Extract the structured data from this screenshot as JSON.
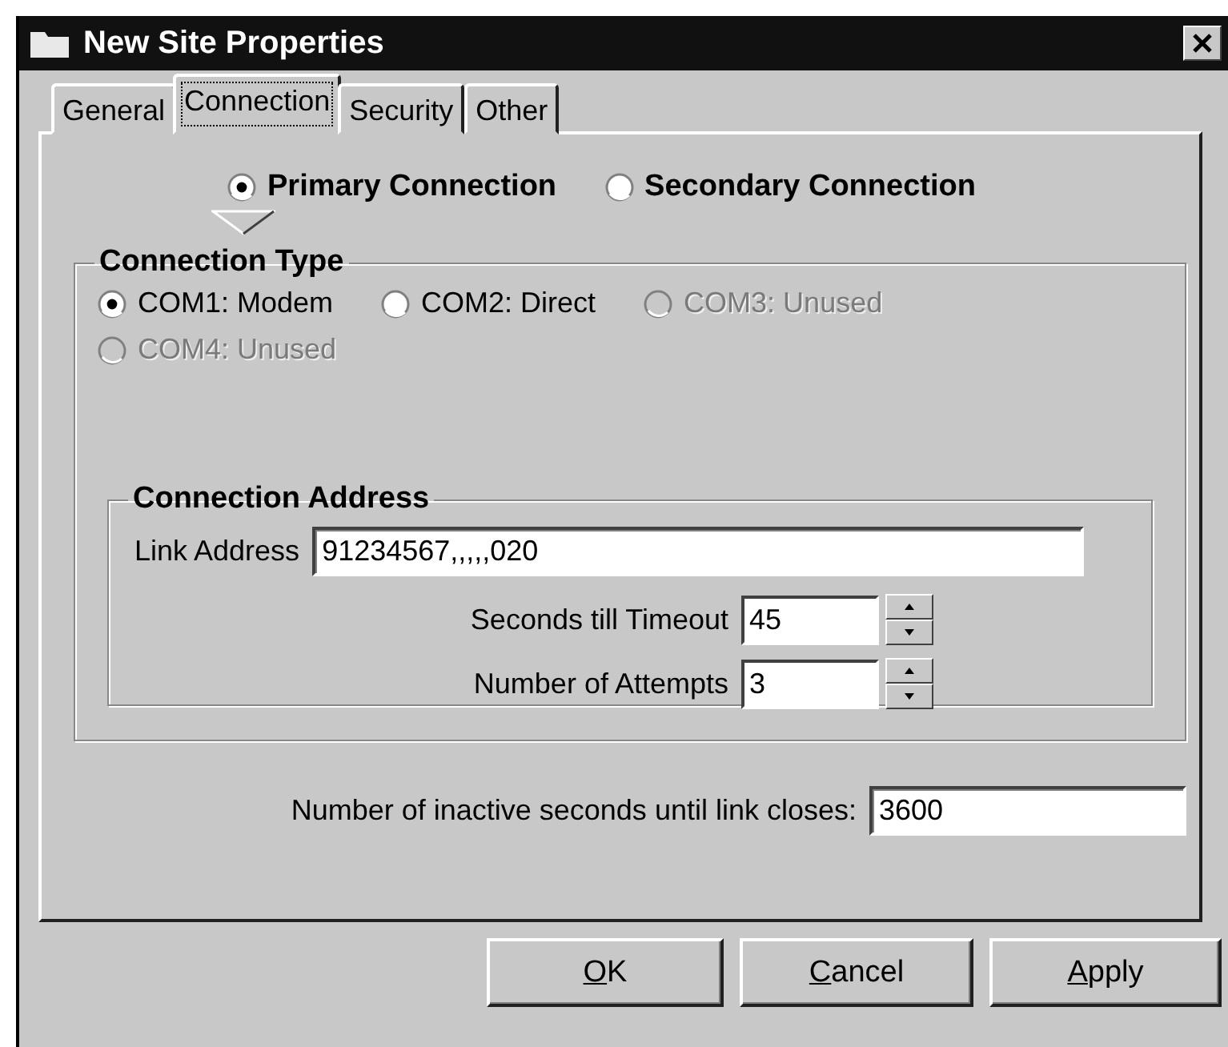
{
  "window": {
    "title": "New Site Properties"
  },
  "tabs": [
    {
      "label": "General",
      "selected": false
    },
    {
      "label": "Connection",
      "selected": true
    },
    {
      "label": "Security",
      "selected": false
    },
    {
      "label": "Other",
      "selected": false
    }
  ],
  "connection_modes": [
    {
      "label": "Primary Connection",
      "selected": true
    },
    {
      "label": "Secondary Connection",
      "selected": false
    }
  ],
  "connection_type": {
    "title": "Connection Type",
    "options": [
      {
        "label": "COM1: Modem",
        "selected": true,
        "disabled": false
      },
      {
        "label": "COM2: Direct",
        "selected": false,
        "disabled": false
      },
      {
        "label": "COM3: Unused",
        "selected": false,
        "disabled": true
      },
      {
        "label": "COM4: Unused",
        "selected": false,
        "disabled": true
      }
    ]
  },
  "connection_address": {
    "title": "Connection Address",
    "link_address": {
      "label": "Link Address",
      "value": "91234567,,,,,020"
    },
    "spinners": [
      {
        "label": "Seconds till Timeout",
        "value": "45"
      },
      {
        "label": "Number of Attempts",
        "value": "3"
      }
    ]
  },
  "inactive": {
    "label": "Number of inactive seconds until link closes:",
    "value": "3600"
  },
  "buttons": [
    {
      "label": "OK",
      "underline_first": true
    },
    {
      "label": "Cancel",
      "underline_first": true
    },
    {
      "label": "Apply",
      "underline_first": true
    }
  ]
}
